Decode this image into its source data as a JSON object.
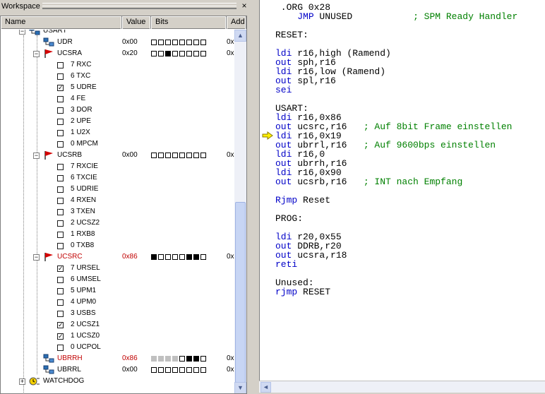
{
  "workspace": {
    "title": "Workspace",
    "columns": [
      "Name",
      "Value",
      "Bits",
      "Add"
    ]
  },
  "tree": [
    {
      "label": "USART",
      "level": 0,
      "icon": "io-module-icon",
      "expander": "minus"
    },
    {
      "label": "UDR",
      "level": 1,
      "icon": "io-register-icon",
      "value": "0x00",
      "bits": "00000000",
      "addr": "0x"
    },
    {
      "label": "UCSRA",
      "level": 1,
      "icon": "red-flag-icon",
      "expander": "minus",
      "value": "0x20",
      "bits": "00100000",
      "addr": "0x"
    },
    {
      "label": "7 RXC",
      "level": 2,
      "checked": false
    },
    {
      "label": "6 TXC",
      "level": 2,
      "checked": false
    },
    {
      "label": "5 UDRE",
      "level": 2,
      "checked": true
    },
    {
      "label": "4 FE",
      "level": 2,
      "checked": false
    },
    {
      "label": "3 DOR",
      "level": 2,
      "checked": false
    },
    {
      "label": "2 UPE",
      "level": 2,
      "checked": false
    },
    {
      "label": "1 U2X",
      "level": 2,
      "checked": false
    },
    {
      "label": "0 MPCM",
      "level": 2,
      "checked": false
    },
    {
      "label": "UCSRB",
      "level": 1,
      "icon": "red-flag-icon",
      "expander": "minus",
      "value": "0x00",
      "bits": "00000000",
      "addr": "0x"
    },
    {
      "label": "7 RXCIE",
      "level": 2,
      "checked": false
    },
    {
      "label": "6 TXCIE",
      "level": 2,
      "checked": false
    },
    {
      "label": "5 UDRIE",
      "level": 2,
      "checked": false
    },
    {
      "label": "4 RXEN",
      "level": 2,
      "checked": false
    },
    {
      "label": "3 TXEN",
      "level": 2,
      "checked": false
    },
    {
      "label": "2 UCSZ2",
      "level": 2,
      "checked": false
    },
    {
      "label": "1 RXB8",
      "level": 2,
      "checked": false
    },
    {
      "label": "0 TXB8",
      "level": 2,
      "checked": false
    },
    {
      "label": "UCSRC",
      "level": 1,
      "icon": "red-flag-icon",
      "expander": "minus",
      "value": "0x86",
      "bits": "10000110",
      "addr": "0x",
      "red": true
    },
    {
      "label": "7 URSEL",
      "level": 2,
      "checked": true
    },
    {
      "label": "6 UMSEL",
      "level": 2,
      "checked": false
    },
    {
      "label": "5 UPM1",
      "level": 2,
      "checked": false
    },
    {
      "label": "4 UPM0",
      "level": 2,
      "checked": false
    },
    {
      "label": "3 USBS",
      "level": 2,
      "checked": false
    },
    {
      "label": "2 UCSZ1",
      "level": 2,
      "checked": true
    },
    {
      "label": "1 UCSZ0",
      "level": 2,
      "checked": true
    },
    {
      "label": "0 UCPOL",
      "level": 2,
      "checked": false
    },
    {
      "label": "UBRRH",
      "level": 1,
      "icon": "io-register-icon",
      "value": "0x86",
      "bits": "gggg0110",
      "addr": "0x",
      "red": true
    },
    {
      "label": "UBRRL",
      "level": 1,
      "icon": "io-register-icon",
      "value": "0x00",
      "bits": "00000000",
      "addr": "0x"
    },
    {
      "label": "WATCHDOG",
      "level": 0,
      "icon": "watchdog-icon",
      "expander": "plus"
    }
  ],
  "scrollbar": {
    "up": "▲",
    "down": "▼",
    "left": "◄"
  },
  "close_glyph": "×",
  "code_lines": [
    [
      {
        "t": " .ORG 0x28"
      }
    ],
    [
      {
        "t": "    "
      },
      {
        "t": "JMP",
        "c": "kw"
      },
      {
        "t": " UNUSED           "
      },
      {
        "t": "; SPM Ready Handler",
        "c": "cm"
      }
    ],
    [
      {
        "t": ""
      }
    ],
    [
      {
        "t": "RESET:"
      }
    ],
    [
      {
        "t": ""
      }
    ],
    [
      {
        "t": "ldi",
        "c": "kw"
      },
      {
        "t": " r16,high (Ramend)"
      }
    ],
    [
      {
        "t": "out",
        "c": "kw"
      },
      {
        "t": " sph,r16"
      }
    ],
    [
      {
        "t": "ldi",
        "c": "kw"
      },
      {
        "t": " r16,low (Ramend)"
      }
    ],
    [
      {
        "t": "out",
        "c": "kw"
      },
      {
        "t": " spl,r16"
      }
    ],
    [
      {
        "t": "sei",
        "c": "kw"
      }
    ],
    [
      {
        "t": ""
      }
    ],
    [
      {
        "t": "USART:"
      }
    ],
    [
      {
        "t": "ldi",
        "c": "kw"
      },
      {
        "t": " r16,0x86"
      }
    ],
    [
      {
        "t": "out",
        "c": "kw"
      },
      {
        "t": " ucsrc,r16   "
      },
      {
        "t": "; Auf 8bit Frame einstellen",
        "c": "cm"
      }
    ],
    [
      {
        "t": "ldi",
        "c": "kw"
      },
      {
        "t": " r16,0x19"
      }
    ],
    [
      {
        "t": "out",
        "c": "kw"
      },
      {
        "t": " ubrrl,r16   "
      },
      {
        "t": "; Auf 9600bps einstellen",
        "c": "cm"
      }
    ],
    [
      {
        "t": "ldi",
        "c": "kw"
      },
      {
        "t": " r16,0"
      }
    ],
    [
      {
        "t": "out",
        "c": "kw"
      },
      {
        "t": " ubrrh,r16"
      }
    ],
    [
      {
        "t": "ldi",
        "c": "kw"
      },
      {
        "t": " r16,0x90"
      }
    ],
    [
      {
        "t": "out",
        "c": "kw"
      },
      {
        "t": " ucsrb,r16   "
      },
      {
        "t": "; INT nach Empfang",
        "c": "cm"
      }
    ],
    [
      {
        "t": ""
      }
    ],
    [
      {
        "t": "Rjmp",
        "c": "kw"
      },
      {
        "t": " Reset"
      }
    ],
    [
      {
        "t": ""
      }
    ],
    [
      {
        "t": "PROG:"
      }
    ],
    [
      {
        "t": ""
      }
    ],
    [
      {
        "t": "ldi",
        "c": "kw"
      },
      {
        "t": " r20,0x55"
      }
    ],
    [
      {
        "t": "out",
        "c": "kw"
      },
      {
        "t": " DDRB,r20"
      }
    ],
    [
      {
        "t": "out",
        "c": "kw"
      },
      {
        "t": " ucsra,r18"
      }
    ],
    [
      {
        "t": "reti",
        "c": "kw"
      }
    ],
    [
      {
        "t": ""
      }
    ],
    [
      {
        "t": "Unused:"
      }
    ],
    [
      {
        "t": "rjmp",
        "c": "kw"
      },
      {
        "t": " RESET"
      }
    ]
  ]
}
